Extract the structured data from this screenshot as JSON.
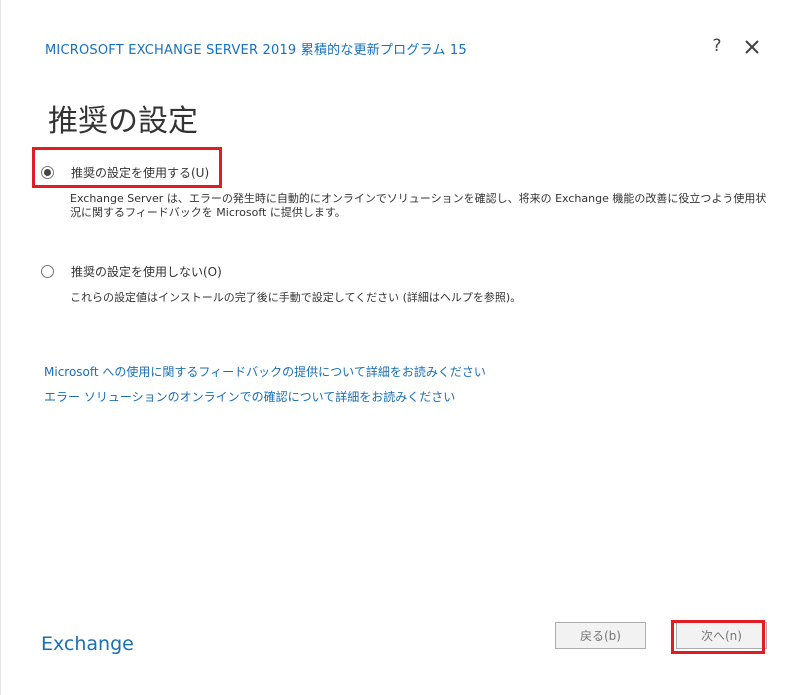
{
  "window": {
    "title": "MICROSOFT EXCHANGE SERVER 2019 累積的な更新プログラム 15",
    "help_label": "?"
  },
  "page": {
    "heading": "推奨の設定"
  },
  "options": [
    {
      "label": "推奨の設定を使用する(U)",
      "selected": true,
      "description": "Exchange Server は、エラーの発生時に自動的にオンラインでソリューションを確認し、将来の Exchange 機能の改善に役立つよう使用状況に関するフィードバックを Microsoft に提供します。"
    },
    {
      "label": "推奨の設定を使用しない(O)",
      "selected": false,
      "description": "これらの設定値はインストールの完了後に手動で設定してください (詳細はヘルプを参照)。"
    }
  ],
  "links": [
    "Microsoft への使用に関するフィードバックの提供について詳細をお読みください",
    "エラー ソリューションのオンラインでの確認について詳細をお読みください"
  ],
  "footer": {
    "brand": "Exchange",
    "back_label": "戻る(b)",
    "next_label": "次へ(n)"
  },
  "colors": {
    "accent": "#1a6fb6",
    "highlight": "#e01c24"
  },
  "icons": {
    "close": "close-icon",
    "help": "help-icon"
  }
}
